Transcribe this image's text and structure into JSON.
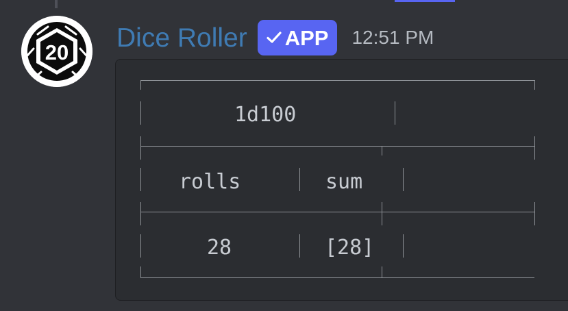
{
  "message": {
    "author": "Dice Roller",
    "badge": "APP",
    "time": "12:51 PM",
    "avatar_text": "20",
    "avatar_icon": "d20-icon"
  },
  "roll_table": {
    "title": "1d100",
    "headers": [
      "rolls",
      "sum"
    ],
    "rows": [
      [
        "28",
        "[28]"
      ]
    ]
  },
  "colors": {
    "background": "#313338",
    "code_background": "#2b2d31",
    "username": "#3f7bb3",
    "badge": "#5865f2",
    "timestamp": "#b5bac1"
  }
}
